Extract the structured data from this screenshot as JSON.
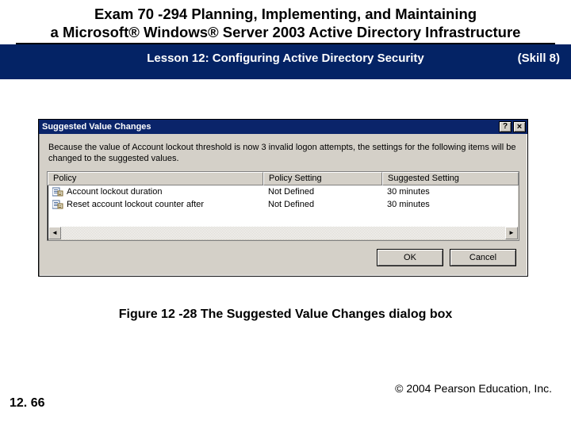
{
  "header": {
    "course_title_line1": "Exam 70 -294 Planning, Implementing, and Maintaining",
    "course_title_line2": "a Microsoft® Windows® Server 2003 Active Directory Infrastructure",
    "lesson": "Lesson 12: Configuring Active Directory Security",
    "skill": "(Skill 8)"
  },
  "dialog": {
    "title": "Suggested Value Changes",
    "help_glyph": "?",
    "close_glyph": "×",
    "explanation": "Because the value of Account lockout threshold is now 3 invalid logon attempts, the settings for the following items will be changed to the suggested values.",
    "columns": [
      "Policy",
      "Policy Setting",
      "Suggested Setting"
    ],
    "rows": [
      {
        "policy": "Account lockout duration",
        "setting": "Not Defined",
        "suggested": "30 minutes"
      },
      {
        "policy": "Reset account lockout counter after",
        "setting": "Not Defined",
        "suggested": "30 minutes"
      }
    ],
    "buttons": {
      "ok": "OK",
      "cancel": "Cancel"
    }
  },
  "figure_caption": "Figure 12 -28 The Suggested Value Changes dialog box",
  "page_number": "12. 66",
  "copyright": "© 2004 Pearson Education, Inc."
}
